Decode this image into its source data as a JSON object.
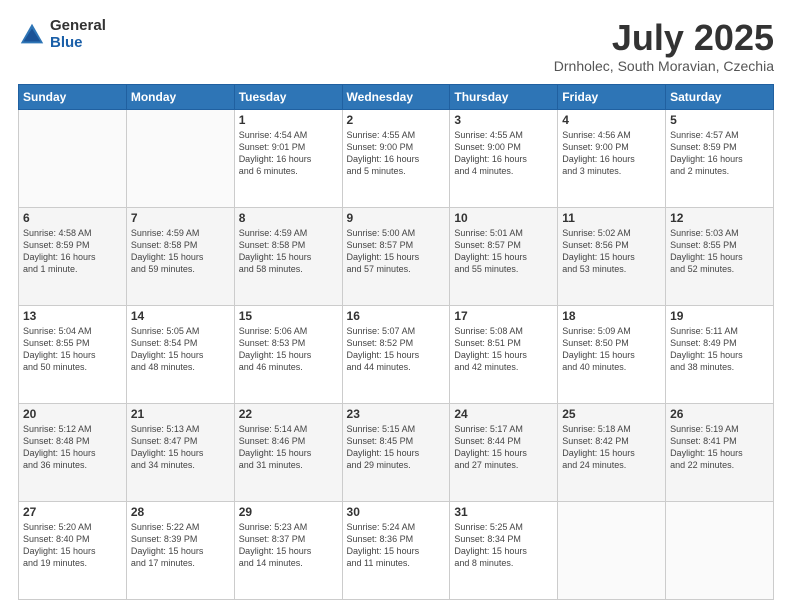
{
  "logo": {
    "general": "General",
    "blue": "Blue"
  },
  "header": {
    "month": "July 2025",
    "location": "Drnholec, South Moravian, Czechia"
  },
  "days_of_week": [
    "Sunday",
    "Monday",
    "Tuesday",
    "Wednesday",
    "Thursday",
    "Friday",
    "Saturday"
  ],
  "weeks": [
    [
      {
        "day": "",
        "lines": []
      },
      {
        "day": "",
        "lines": []
      },
      {
        "day": "1",
        "lines": [
          "Sunrise: 4:54 AM",
          "Sunset: 9:01 PM",
          "Daylight: 16 hours",
          "and 6 minutes."
        ]
      },
      {
        "day": "2",
        "lines": [
          "Sunrise: 4:55 AM",
          "Sunset: 9:00 PM",
          "Daylight: 16 hours",
          "and 5 minutes."
        ]
      },
      {
        "day": "3",
        "lines": [
          "Sunrise: 4:55 AM",
          "Sunset: 9:00 PM",
          "Daylight: 16 hours",
          "and 4 minutes."
        ]
      },
      {
        "day": "4",
        "lines": [
          "Sunrise: 4:56 AM",
          "Sunset: 9:00 PM",
          "Daylight: 16 hours",
          "and 3 minutes."
        ]
      },
      {
        "day": "5",
        "lines": [
          "Sunrise: 4:57 AM",
          "Sunset: 8:59 PM",
          "Daylight: 16 hours",
          "and 2 minutes."
        ]
      }
    ],
    [
      {
        "day": "6",
        "lines": [
          "Sunrise: 4:58 AM",
          "Sunset: 8:59 PM",
          "Daylight: 16 hours",
          "and 1 minute."
        ]
      },
      {
        "day": "7",
        "lines": [
          "Sunrise: 4:59 AM",
          "Sunset: 8:58 PM",
          "Daylight: 15 hours",
          "and 59 minutes."
        ]
      },
      {
        "day": "8",
        "lines": [
          "Sunrise: 4:59 AM",
          "Sunset: 8:58 PM",
          "Daylight: 15 hours",
          "and 58 minutes."
        ]
      },
      {
        "day": "9",
        "lines": [
          "Sunrise: 5:00 AM",
          "Sunset: 8:57 PM",
          "Daylight: 15 hours",
          "and 57 minutes."
        ]
      },
      {
        "day": "10",
        "lines": [
          "Sunrise: 5:01 AM",
          "Sunset: 8:57 PM",
          "Daylight: 15 hours",
          "and 55 minutes."
        ]
      },
      {
        "day": "11",
        "lines": [
          "Sunrise: 5:02 AM",
          "Sunset: 8:56 PM",
          "Daylight: 15 hours",
          "and 53 minutes."
        ]
      },
      {
        "day": "12",
        "lines": [
          "Sunrise: 5:03 AM",
          "Sunset: 8:55 PM",
          "Daylight: 15 hours",
          "and 52 minutes."
        ]
      }
    ],
    [
      {
        "day": "13",
        "lines": [
          "Sunrise: 5:04 AM",
          "Sunset: 8:55 PM",
          "Daylight: 15 hours",
          "and 50 minutes."
        ]
      },
      {
        "day": "14",
        "lines": [
          "Sunrise: 5:05 AM",
          "Sunset: 8:54 PM",
          "Daylight: 15 hours",
          "and 48 minutes."
        ]
      },
      {
        "day": "15",
        "lines": [
          "Sunrise: 5:06 AM",
          "Sunset: 8:53 PM",
          "Daylight: 15 hours",
          "and 46 minutes."
        ]
      },
      {
        "day": "16",
        "lines": [
          "Sunrise: 5:07 AM",
          "Sunset: 8:52 PM",
          "Daylight: 15 hours",
          "and 44 minutes."
        ]
      },
      {
        "day": "17",
        "lines": [
          "Sunrise: 5:08 AM",
          "Sunset: 8:51 PM",
          "Daylight: 15 hours",
          "and 42 minutes."
        ]
      },
      {
        "day": "18",
        "lines": [
          "Sunrise: 5:09 AM",
          "Sunset: 8:50 PM",
          "Daylight: 15 hours",
          "and 40 minutes."
        ]
      },
      {
        "day": "19",
        "lines": [
          "Sunrise: 5:11 AM",
          "Sunset: 8:49 PM",
          "Daylight: 15 hours",
          "and 38 minutes."
        ]
      }
    ],
    [
      {
        "day": "20",
        "lines": [
          "Sunrise: 5:12 AM",
          "Sunset: 8:48 PM",
          "Daylight: 15 hours",
          "and 36 minutes."
        ]
      },
      {
        "day": "21",
        "lines": [
          "Sunrise: 5:13 AM",
          "Sunset: 8:47 PM",
          "Daylight: 15 hours",
          "and 34 minutes."
        ]
      },
      {
        "day": "22",
        "lines": [
          "Sunrise: 5:14 AM",
          "Sunset: 8:46 PM",
          "Daylight: 15 hours",
          "and 31 minutes."
        ]
      },
      {
        "day": "23",
        "lines": [
          "Sunrise: 5:15 AM",
          "Sunset: 8:45 PM",
          "Daylight: 15 hours",
          "and 29 minutes."
        ]
      },
      {
        "day": "24",
        "lines": [
          "Sunrise: 5:17 AM",
          "Sunset: 8:44 PM",
          "Daylight: 15 hours",
          "and 27 minutes."
        ]
      },
      {
        "day": "25",
        "lines": [
          "Sunrise: 5:18 AM",
          "Sunset: 8:42 PM",
          "Daylight: 15 hours",
          "and 24 minutes."
        ]
      },
      {
        "day": "26",
        "lines": [
          "Sunrise: 5:19 AM",
          "Sunset: 8:41 PM",
          "Daylight: 15 hours",
          "and 22 minutes."
        ]
      }
    ],
    [
      {
        "day": "27",
        "lines": [
          "Sunrise: 5:20 AM",
          "Sunset: 8:40 PM",
          "Daylight: 15 hours",
          "and 19 minutes."
        ]
      },
      {
        "day": "28",
        "lines": [
          "Sunrise: 5:22 AM",
          "Sunset: 8:39 PM",
          "Daylight: 15 hours",
          "and 17 minutes."
        ]
      },
      {
        "day": "29",
        "lines": [
          "Sunrise: 5:23 AM",
          "Sunset: 8:37 PM",
          "Daylight: 15 hours",
          "and 14 minutes."
        ]
      },
      {
        "day": "30",
        "lines": [
          "Sunrise: 5:24 AM",
          "Sunset: 8:36 PM",
          "Daylight: 15 hours",
          "and 11 minutes."
        ]
      },
      {
        "day": "31",
        "lines": [
          "Sunrise: 5:25 AM",
          "Sunset: 8:34 PM",
          "Daylight: 15 hours",
          "and 8 minutes."
        ]
      },
      {
        "day": "",
        "lines": []
      },
      {
        "day": "",
        "lines": []
      }
    ]
  ]
}
